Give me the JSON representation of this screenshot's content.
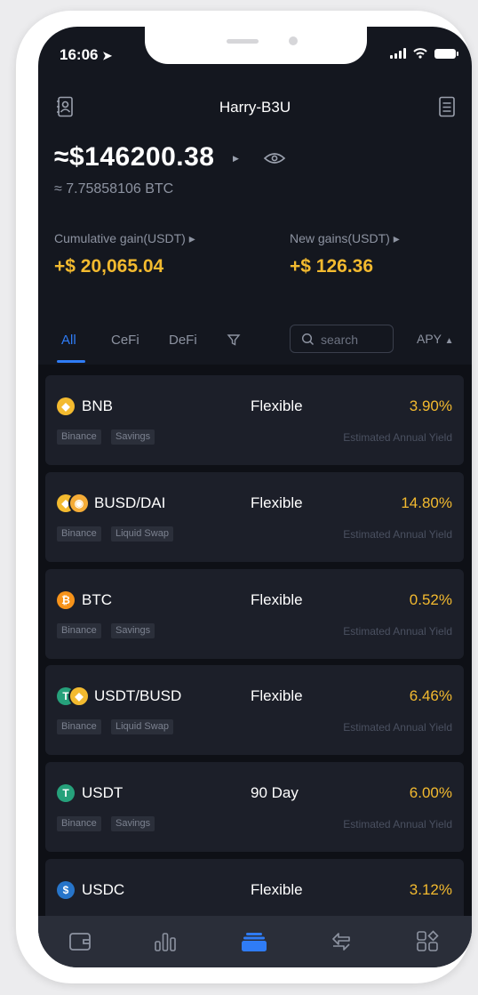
{
  "status_bar": {
    "time": "16:06"
  },
  "header": {
    "title": "Harry-B3U"
  },
  "balance": {
    "usd": "≈$146200.38",
    "btc": "≈ 7.75858106 BTC"
  },
  "gains": {
    "cumulative_label": "Cumulative gain(USDT) ▸",
    "cumulative_value": "+$ 20,065.04",
    "new_label": "New gains(USDT) ▸",
    "new_value": "+$ 126.36"
  },
  "tabs": [
    {
      "label": "All",
      "active": true
    },
    {
      "label": "CeFi",
      "active": false
    },
    {
      "label": "DeFi",
      "active": false
    }
  ],
  "search": {
    "placeholder": "search"
  },
  "sort": {
    "label": "APY"
  },
  "cards": [
    {
      "name": "BNB",
      "term": "Flexible",
      "rate": "3.90%",
      "tags": [
        "Binance",
        "Savings"
      ],
      "yield_label": "Estimated Annual Yield",
      "icons": [
        "bnb-coin-icon"
      ]
    },
    {
      "name": "BUSD/DAI",
      "term": "Flexible",
      "rate": "14.80%",
      "tags": [
        "Binance",
        "Liquid Swap"
      ],
      "yield_label": "Estimated Annual Yield",
      "icons": [
        "busd-coin-icon",
        "dai-coin-icon"
      ]
    },
    {
      "name": "BTC",
      "term": "Flexible",
      "rate": "0.52%",
      "tags": [
        "Binance",
        "Savings"
      ],
      "yield_label": "Estimated Annual Yield",
      "icons": [
        "btc-coin-icon"
      ]
    },
    {
      "name": "USDT/BUSD",
      "term": "Flexible",
      "rate": "6.46%",
      "tags": [
        "Binance",
        "Liquid Swap"
      ],
      "yield_label": "Estimated Annual Yield",
      "icons": [
        "usdt-coin-icon",
        "busd-coin-icon"
      ]
    },
    {
      "name": "USDT",
      "term": "90 Day",
      "rate": "6.00%",
      "tags": [
        "Binance",
        "Savings"
      ],
      "yield_label": "Estimated Annual Yield",
      "icons": [
        "usdt-coin-icon"
      ]
    },
    {
      "name": "USDC",
      "term": "Flexible",
      "rate": "3.12%",
      "tags": [
        "",
        ""
      ],
      "yield_label": "",
      "icons": [
        "usdc-coin-icon"
      ]
    }
  ],
  "bottom_nav": [
    {
      "icon": "wallet-icon",
      "active": false
    },
    {
      "icon": "bar-chart-icon",
      "active": false
    },
    {
      "icon": "earn-stack-icon",
      "active": true
    },
    {
      "icon": "swap-arrows-icon",
      "active": false
    },
    {
      "icon": "apps-grid-icon",
      "active": false
    }
  ],
  "colors": {
    "background": "#14171f",
    "card": "#1c1f29",
    "accent_yellow": "#f3ba2f",
    "accent_blue": "#2f7cf6",
    "bnb": "#f3ba2f",
    "btc": "#f7931a",
    "usdt": "#26a17b",
    "usdc": "#2775ca"
  }
}
